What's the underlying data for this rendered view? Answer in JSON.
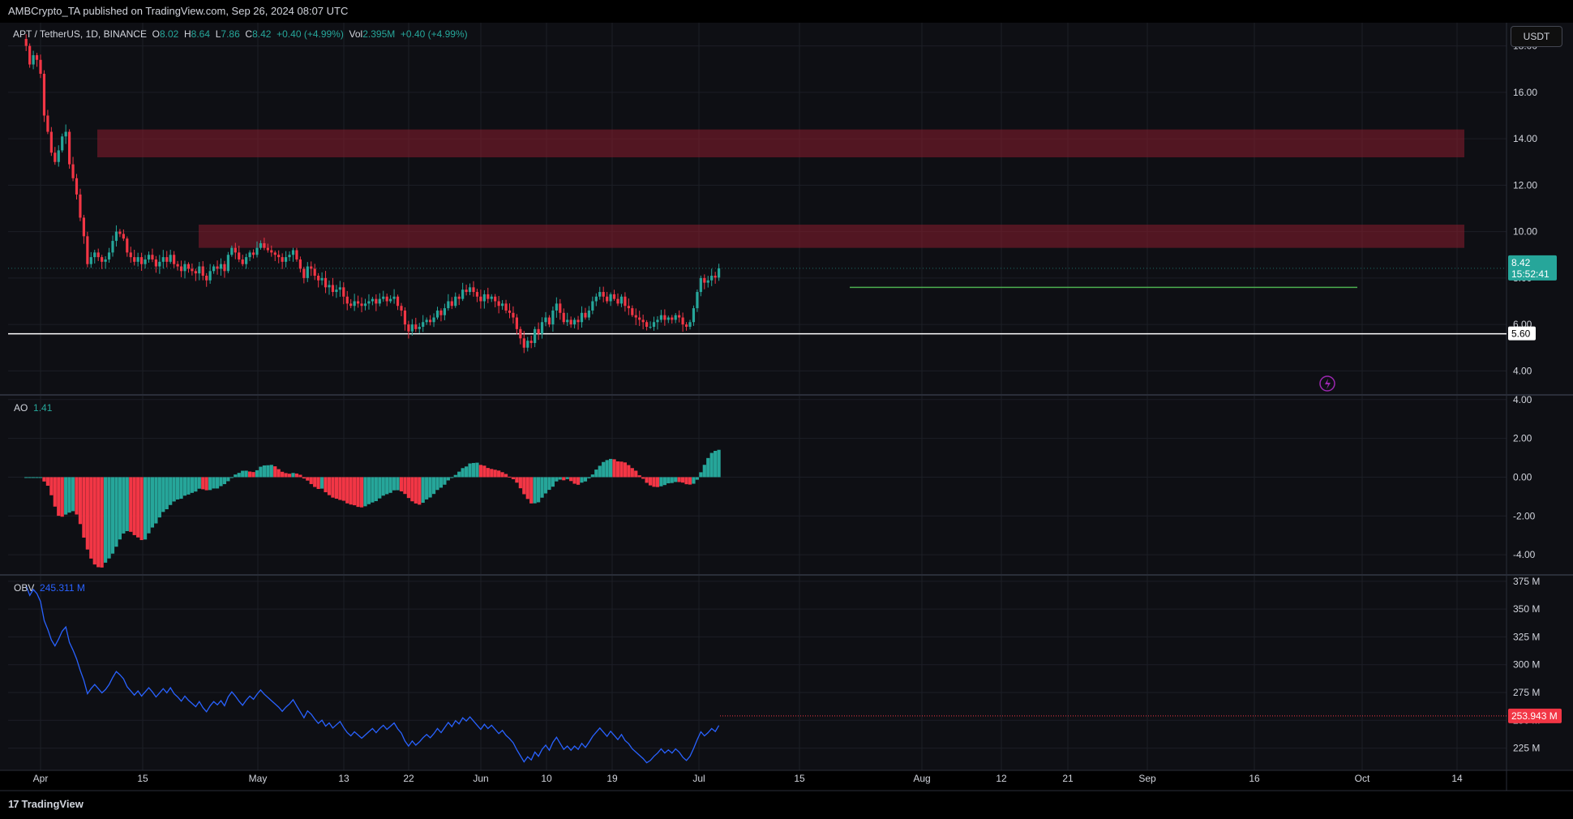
{
  "header": {
    "publisher_line": "AMBCrypto_TA published on TradingView.com, Sep 26, 2024 08:07 UTC"
  },
  "legend": {
    "symbol": "APT / TetherUS, 1D, BINANCE",
    "open_label": "O",
    "open": "8.02",
    "high_label": "H",
    "high": "8.64",
    "low_label": "L",
    "low": "7.86",
    "close_label": "C",
    "close": "8.42",
    "change": "+0.40 (+4.99%)",
    "vol_label": "Vol",
    "vol": "2.395M",
    "vol_change": "+0.40 (+4.99%)"
  },
  "currency_button": "USDT",
  "price_badge": {
    "price": "8.42",
    "countdown": "15:52:41"
  },
  "support_badge": "5.60",
  "ao": {
    "label": "AO",
    "value": "1.41"
  },
  "obv": {
    "label": "OBV",
    "value": "245.311 M",
    "badge": "253.943 M"
  },
  "footer": {
    "brand": "TradingView",
    "mark": "17"
  },
  "colors": {
    "background": "#000000",
    "up": "#26a69a",
    "down": "#f23645",
    "obv_line": "#2962ff",
    "support_line": "#ffffff",
    "range_line": "#4caf50",
    "zone": "#8b1e2e"
  },
  "chart_data": [
    {
      "type": "candlestick",
      "title": "APT / TetherUS, 1D, BINANCE",
      "ylim": [
        3.0,
        19.0
      ],
      "y_ticks": [
        "18.00",
        "16.00",
        "14.00",
        "12.00",
        "10.00",
        "8.00",
        "6.00",
        "4.00"
      ],
      "x_ticks": [
        "Apr",
        "15",
        "May",
        "13",
        "22",
        "Jun",
        "10",
        "19",
        "Jul",
        "15",
        "Aug",
        "12",
        "21",
        "Sep",
        "16",
        "Oct",
        "14"
      ],
      "zones": [
        {
          "from": 13.2,
          "to": 14.4
        },
        {
          "from": 9.3,
          "to": 10.3
        }
      ],
      "lines": [
        {
          "name": "support",
          "value": 5.6
        },
        {
          "name": "range-high",
          "value": 7.6
        }
      ],
      "closes": [
        18.0,
        17.2,
        17.6,
        17.4,
        16.8,
        15.0,
        14.3,
        13.4,
        13.0,
        13.5,
        14.1,
        14.3,
        12.9,
        12.3,
        11.6,
        10.6,
        9.8,
        8.6,
        8.9,
        9.1,
        8.9,
        8.7,
        8.8,
        9.1,
        9.6,
        10.0,
        9.9,
        9.7,
        9.1,
        8.9,
        8.7,
        8.9,
        8.6,
        8.8,
        9.0,
        8.8,
        8.5,
        8.7,
        8.9,
        8.7,
        9.0,
        8.6,
        8.5,
        8.3,
        8.6,
        8.4,
        8.3,
        8.2,
        8.5,
        8.1,
        7.9,
        8.3,
        8.5,
        8.4,
        8.6,
        8.3,
        9.0,
        9.3,
        9.1,
        8.8,
        8.6,
        8.9,
        9.1,
        9.0,
        9.3,
        9.5,
        9.3,
        9.2,
        9.1,
        9.0,
        8.9,
        8.7,
        8.9,
        9.0,
        9.2,
        8.8,
        8.4,
        8.0,
        8.5,
        8.4,
        8.1,
        7.9,
        8.0,
        7.6,
        7.7,
        7.4,
        7.5,
        7.6,
        7.2,
        6.9,
        6.8,
        7.0,
        6.9,
        6.8,
        6.9,
        7.0,
        7.1,
        6.9,
        7.1,
        7.2,
        7.0,
        7.1,
        7.2,
        6.8,
        6.6,
        6.0,
        5.7,
        6.0,
        5.8,
        5.9,
        6.1,
        6.2,
        6.1,
        6.3,
        6.6,
        6.4,
        6.7,
        7.0,
        6.8,
        7.2,
        7.1,
        7.5,
        7.4,
        7.6,
        7.4,
        7.2,
        7.0,
        7.3,
        7.1,
        7.2,
        7.0,
        6.8,
        6.9,
        6.6,
        6.5,
        6.3,
        5.8,
        5.4,
        5.0,
        5.3,
        5.2,
        5.8,
        5.6,
        6.1,
        6.3,
        6.0,
        6.6,
        6.9,
        6.5,
        6.1,
        6.2,
        6.0,
        6.2,
        6.1,
        6.5,
        6.3,
        6.6,
        7.0,
        7.2,
        7.4,
        7.2,
        7.0,
        7.3,
        7.1,
        6.9,
        7.2,
        6.8,
        6.7,
        6.4,
        6.3,
        6.2,
        6.1,
        5.9,
        5.9,
        6.1,
        6.2,
        6.4,
        6.2,
        6.3,
        6.2,
        6.4,
        6.3,
        6.0,
        5.9,
        6.1,
        6.7,
        7.4,
        8.0,
        7.8,
        7.9,
        8.1,
        8.02,
        8.42
      ]
    },
    {
      "type": "histogram",
      "title": "AO",
      "ylim": [
        -5.0,
        4.2
      ],
      "y_ticks": [
        "4.00",
        "2.00",
        "0.00",
        "-2.00",
        "-4.00"
      ],
      "series_name": "AO",
      "last_value": 1.41
    },
    {
      "type": "line",
      "title": "OBV",
      "ylim": [
        205,
        380
      ],
      "y_ticks": [
        "375 M",
        "350 M",
        "325 M",
        "300 M",
        "275 M",
        "250 M",
        "225 M"
      ],
      "series_name": "OBV",
      "last_value_text": "245.311 M",
      "reference_value": 253.943
    }
  ]
}
